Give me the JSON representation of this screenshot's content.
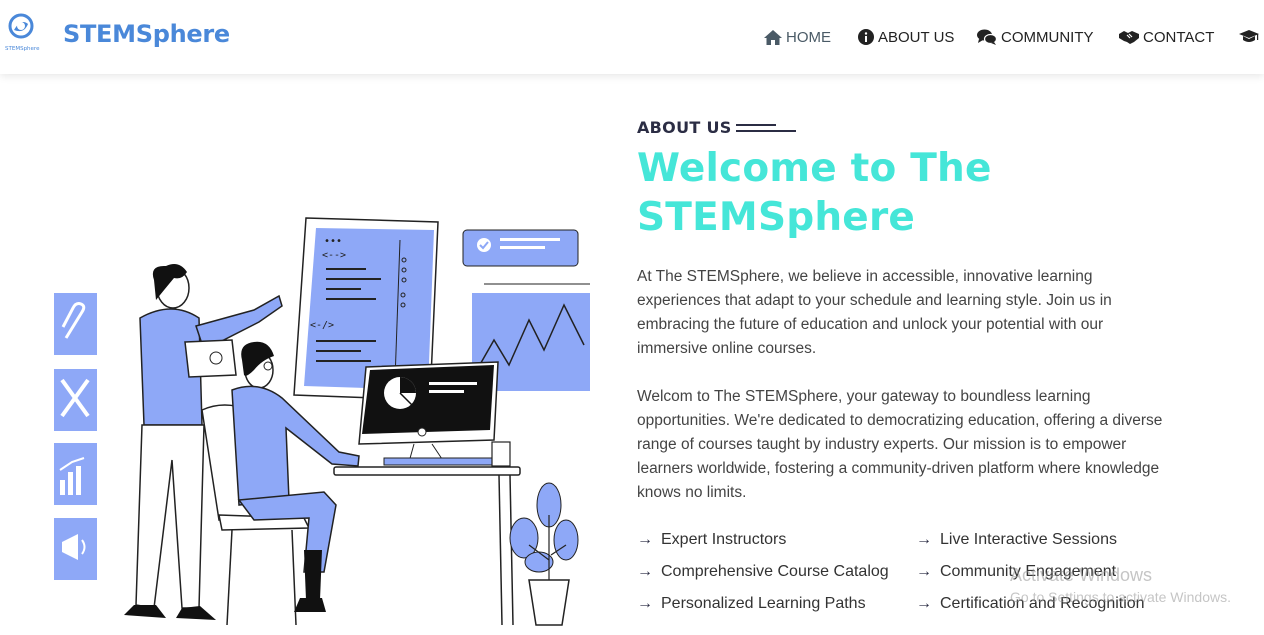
{
  "navbar": {
    "brand": "STEMSphere",
    "logo_text": "STEMSphere",
    "links": [
      {
        "label": "HOME",
        "icon": "home-icon"
      },
      {
        "label": "ABOUT US",
        "icon": "info-icon"
      },
      {
        "label": "COMMUNITY",
        "icon": "comments-icon"
      },
      {
        "label": "CONTACT",
        "icon": "handshake-icon"
      },
      {
        "label": "",
        "icon": "graduation-cap-icon"
      }
    ]
  },
  "about": {
    "eyebrow": "ABOUT US",
    "title_line1": "Welcome to The",
    "title_line2": "STEMSphere",
    "paragraph1": "At The STEMSphere, we believe in accessible, innovative learning experiences that adapt to your schedule and learning style. Join us in embracing the future of education and unlock your potential with our immersive online courses.",
    "paragraph2": "Welcom to The STEMSphere, your gateway to boundless learning opportunities. We're dedicated to democratizing education, offering a diverse range of courses taught by industry experts. Our mission is to empower learners worldwide, fostering a community-driven platform where knowledge knows no limits.",
    "features": [
      "Expert Instructors",
      "Live Interactive Sessions",
      "Comprehensive Course Catalog",
      "Community Engagement",
      "Personalized Learning Paths",
      "Certification and Recognition"
    ]
  },
  "watermark": {
    "line1": "Activate Windows",
    "line2": "Go to Settings to activate Windows."
  },
  "colors": {
    "brand": "#4a88d9",
    "accent": "#45e6d8",
    "illustration": "#8ea8f7"
  }
}
